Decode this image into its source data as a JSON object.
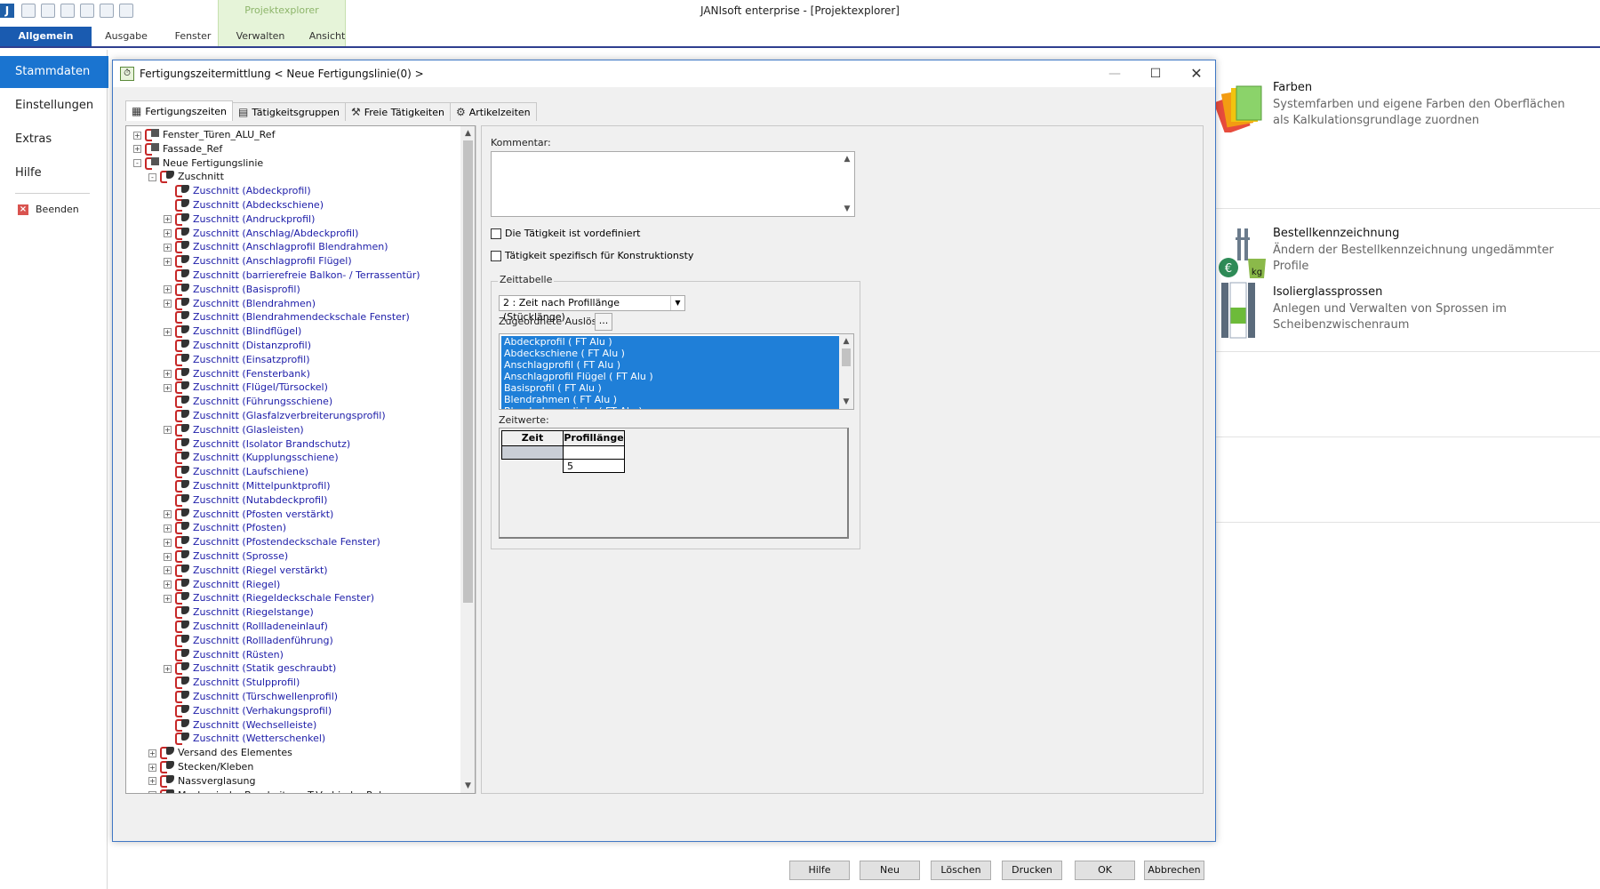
{
  "app": {
    "window_title": "JANIsoft enterprise - [Projektexplorer]",
    "icon_letter": "J",
    "context_tab": "Projektexplorer"
  },
  "ribbon": {
    "tabs": [
      "Allgemein",
      "Ausgabe",
      "Fenster",
      "Verwalten",
      "Ansicht"
    ]
  },
  "nav": {
    "items": [
      "Stammdaten",
      "Einstellungen",
      "Extras",
      "Hilfe"
    ],
    "beenden": "Beenden"
  },
  "right_panel": [
    {
      "title": "Farben",
      "desc": "Systemfarben und eigene Farben den Oberflächen als Kalkulationsgrundlage zuordnen"
    },
    {
      "title": "Bestellkennzeichnung",
      "desc": "Ändern der Bestellkennzeichnung ungedämmter Profile"
    },
    {
      "title": "Isolierglassprossen",
      "desc": "Anlegen und Verwalten von Sprossen im Scheibenzwischenraum"
    }
  ],
  "dialog": {
    "title": "Fertigungszeitermittlung < Neue Fertigungslinie(0) >",
    "tabs": [
      "Fertigungszeiten",
      "Tätigkeitsgruppen",
      "Freie Tätigkeiten",
      "Artikelzeiten"
    ],
    "tree": [
      {
        "label": "Fenster_Türen_ALU_Ref",
        "level": 0,
        "exp": "+",
        "color": "black",
        "icon": "sheet"
      },
      {
        "label": "Fassade_Ref",
        "level": 0,
        "exp": "+",
        "color": "black",
        "icon": "sheet"
      },
      {
        "label": "Neue Fertigungslinie",
        "level": 0,
        "exp": "-",
        "color": "black",
        "icon": "sheet"
      },
      {
        "label": "Zuschnitt",
        "level": 1,
        "exp": "-",
        "color": "black",
        "icon": "tool"
      },
      {
        "label": "Zuschnitt (Abdeckprofil)",
        "level": 2,
        "exp": "",
        "color": "blue",
        "icon": "tool"
      },
      {
        "label": "Zuschnitt (Abdeckschiene)",
        "level": 2,
        "exp": "",
        "color": "blue",
        "icon": "tool"
      },
      {
        "label": "Zuschnitt (Andruckprofil)",
        "level": 2,
        "exp": "+",
        "color": "blue",
        "icon": "tool"
      },
      {
        "label": "Zuschnitt (Anschlag/Abdeckprofil)",
        "level": 2,
        "exp": "+",
        "color": "blue",
        "icon": "tool"
      },
      {
        "label": "Zuschnitt (Anschlagprofil Blendrahmen)",
        "level": 2,
        "exp": "+",
        "color": "blue",
        "icon": "tool"
      },
      {
        "label": "Zuschnitt (Anschlagprofil Flügel)",
        "level": 2,
        "exp": "+",
        "color": "blue",
        "icon": "tool"
      },
      {
        "label": "Zuschnitt (barrierefreie Balkon- / Terrassentür)",
        "level": 2,
        "exp": "",
        "color": "blue",
        "icon": "tool"
      },
      {
        "label": "Zuschnitt (Basisprofil)",
        "level": 2,
        "exp": "+",
        "color": "blue",
        "icon": "tool"
      },
      {
        "label": "Zuschnitt (Blendrahmen)",
        "level": 2,
        "exp": "+",
        "color": "blue",
        "icon": "tool"
      },
      {
        "label": "Zuschnitt (Blendrahmendeckschale Fenster)",
        "level": 2,
        "exp": "",
        "color": "blue",
        "icon": "tool"
      },
      {
        "label": "Zuschnitt (Blindflügel)",
        "level": 2,
        "exp": "+",
        "color": "blue",
        "icon": "tool"
      },
      {
        "label": "Zuschnitt (Distanzprofil)",
        "level": 2,
        "exp": "",
        "color": "blue",
        "icon": "tool"
      },
      {
        "label": "Zuschnitt (Einsatzprofil)",
        "level": 2,
        "exp": "",
        "color": "blue",
        "icon": "tool"
      },
      {
        "label": "Zuschnitt (Fensterbank)",
        "level": 2,
        "exp": "+",
        "color": "blue",
        "icon": "tool"
      },
      {
        "label": "Zuschnitt (Flügel/Türsockel)",
        "level": 2,
        "exp": "+",
        "color": "blue",
        "icon": "tool"
      },
      {
        "label": "Zuschnitt (Führungsschiene)",
        "level": 2,
        "exp": "",
        "color": "blue",
        "icon": "tool"
      },
      {
        "label": "Zuschnitt (Glasfalzverbreiterungsprofil)",
        "level": 2,
        "exp": "",
        "color": "blue",
        "icon": "tool"
      },
      {
        "label": "Zuschnitt (Glasleisten)",
        "level": 2,
        "exp": "+",
        "color": "blue",
        "icon": "tool"
      },
      {
        "label": "Zuschnitt (Isolator Brandschutz)",
        "level": 2,
        "exp": "",
        "color": "blue",
        "icon": "tool"
      },
      {
        "label": "Zuschnitt (Kupplungsschiene)",
        "level": 2,
        "exp": "",
        "color": "blue",
        "icon": "tool"
      },
      {
        "label": "Zuschnitt (Laufschiene)",
        "level": 2,
        "exp": "",
        "color": "blue",
        "icon": "tool"
      },
      {
        "label": "Zuschnitt (Mittelpunktprofil)",
        "level": 2,
        "exp": "",
        "color": "blue",
        "icon": "tool"
      },
      {
        "label": "Zuschnitt (Nutabdeckprofil)",
        "level": 2,
        "exp": "",
        "color": "blue",
        "icon": "tool"
      },
      {
        "label": "Zuschnitt (Pfosten verstärkt)",
        "level": 2,
        "exp": "+",
        "color": "blue",
        "icon": "tool"
      },
      {
        "label": "Zuschnitt (Pfosten)",
        "level": 2,
        "exp": "+",
        "color": "blue",
        "icon": "tool"
      },
      {
        "label": "Zuschnitt (Pfostendeckschale Fenster)",
        "level": 2,
        "exp": "+",
        "color": "blue",
        "icon": "tool"
      },
      {
        "label": "Zuschnitt (Sprosse)",
        "level": 2,
        "exp": "+",
        "color": "blue",
        "icon": "tool"
      },
      {
        "label": "Zuschnitt (Riegel verstärkt)",
        "level": 2,
        "exp": "+",
        "color": "blue",
        "icon": "tool"
      },
      {
        "label": "Zuschnitt (Riegel)",
        "level": 2,
        "exp": "+",
        "color": "blue",
        "icon": "tool"
      },
      {
        "label": "Zuschnitt (Riegeldeckschale Fenster)",
        "level": 2,
        "exp": "+",
        "color": "blue",
        "icon": "tool"
      },
      {
        "label": "Zuschnitt (Riegelstange)",
        "level": 2,
        "exp": "",
        "color": "blue",
        "icon": "tool"
      },
      {
        "label": "Zuschnitt (Rollladeneinlauf)",
        "level": 2,
        "exp": "",
        "color": "blue",
        "icon": "tool"
      },
      {
        "label": "Zuschnitt (Rollladenführung)",
        "level": 2,
        "exp": "",
        "color": "blue",
        "icon": "tool"
      },
      {
        "label": "Zuschnitt (Rüsten)",
        "level": 2,
        "exp": "",
        "color": "blue",
        "icon": "tool"
      },
      {
        "label": "Zuschnitt (Statik geschraubt)",
        "level": 2,
        "exp": "+",
        "color": "blue",
        "icon": "tool"
      },
      {
        "label": "Zuschnitt (Stulpprofil)",
        "level": 2,
        "exp": "",
        "color": "blue",
        "icon": "tool"
      },
      {
        "label": "Zuschnitt (Türschwellenprofil)",
        "level": 2,
        "exp": "",
        "color": "blue",
        "icon": "tool"
      },
      {
        "label": "Zuschnitt (Verhakungsprofil)",
        "level": 2,
        "exp": "",
        "color": "blue",
        "icon": "tool"
      },
      {
        "label": "Zuschnitt (Wechselleiste)",
        "level": 2,
        "exp": "",
        "color": "blue",
        "icon": "tool"
      },
      {
        "label": "Zuschnitt (Wetterschenkel)",
        "level": 2,
        "exp": "",
        "color": "blue",
        "icon": "tool"
      },
      {
        "label": "Versand des Elementes",
        "level": 1,
        "exp": "+",
        "color": "black",
        "icon": "tool"
      },
      {
        "label": "Stecken/Kleben",
        "level": 1,
        "exp": "+",
        "color": "black",
        "icon": "tool"
      },
      {
        "label": "Nassverglasung",
        "level": 1,
        "exp": "+",
        "color": "black",
        "icon": "tool"
      },
      {
        "label": "Mechanische Bearbeitung T-Verbinder Rahmen",
        "level": 1,
        "exp": "+",
        "color": "black",
        "icon": "tool"
      }
    ],
    "form": {
      "kommentar_label": "Kommentar:",
      "kommentar_value": "",
      "chk_vordefiniert": "Die Tätigkeit ist vordefiniert",
      "chk_konstruktionstyp": "Tätigkeit spezifisch für Konstruktionsty",
      "zeittabelle_label": "Zeittabelle",
      "zeittabelle_value": "2 :  Zeit nach Profillänge (Stücklänge)",
      "ausloser_label": "Zugeordnete Auslöser:",
      "ausloser_button": "...",
      "ausloser_items": [
        "Abdeckprofil ( FT Alu )",
        "Abdeckschiene ( FT Alu )",
        "Anschlagprofil ( FT Alu )",
        "Anschlagprofil Flügel ( FT Alu )",
        "Basisprofil ( FT Alu )",
        "Blendrahmen ( FT Alu )",
        "Blendrahmen links ( FT Alu )"
      ],
      "zeitwerte_label": "Zeitwerte:",
      "grid_headers": [
        "Zeit",
        "Profillänge"
      ],
      "grid_value": "5"
    },
    "buttons": [
      "Hilfe",
      "Neu",
      "Löschen",
      "Drucken",
      "OK",
      "Abbrechen"
    ]
  }
}
